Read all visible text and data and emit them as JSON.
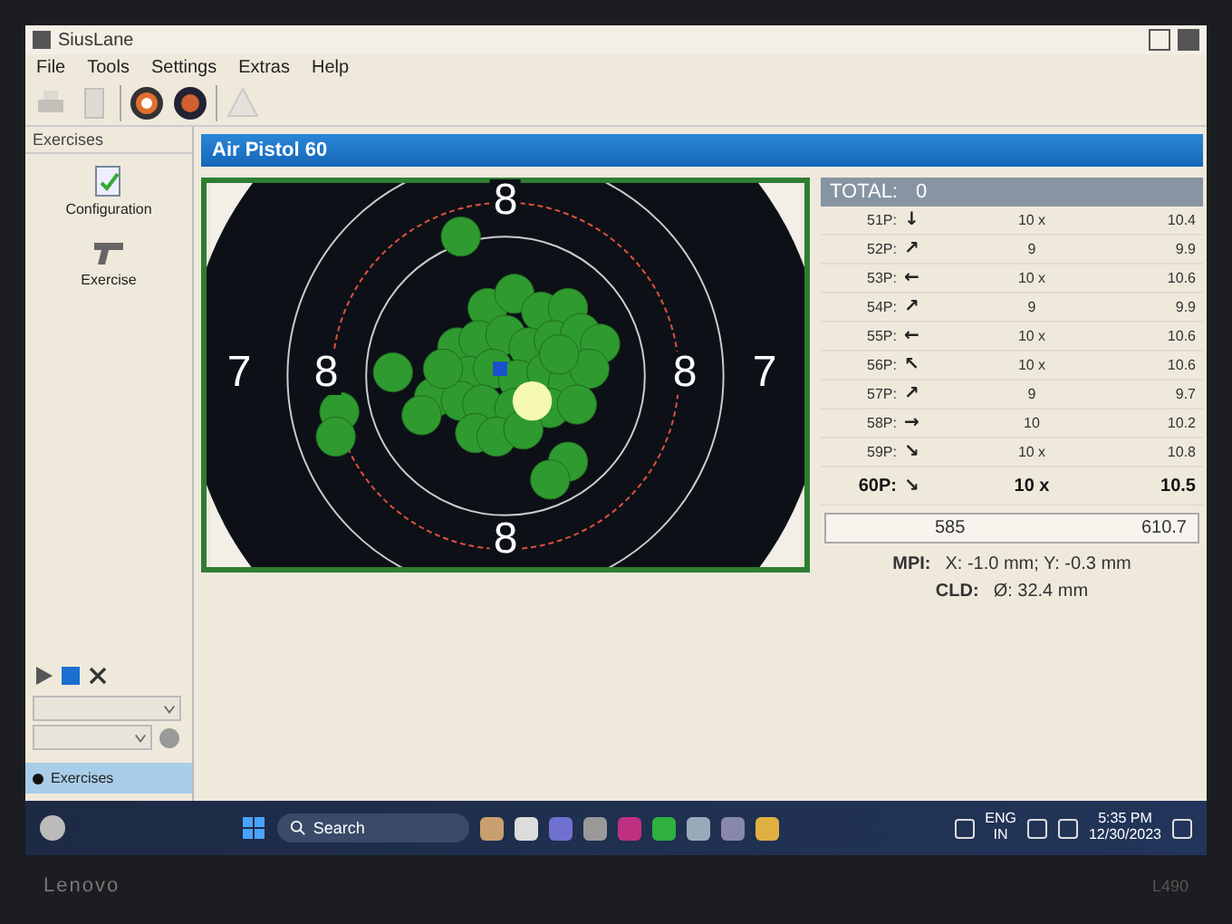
{
  "window": {
    "title": "SiusLane"
  },
  "menu": [
    "File",
    "Tools",
    "Settings",
    "Extras",
    "Help"
  ],
  "toolbar": [
    {
      "kind": "print",
      "disabled": true
    },
    {
      "kind": "document",
      "disabled": true
    },
    {
      "kind": "target",
      "disabled": false
    },
    {
      "kind": "target-dark",
      "disabled": false
    },
    {
      "kind": "warning",
      "disabled": true
    }
  ],
  "sidebar": {
    "title": "Exercises",
    "items": [
      {
        "kind": "configuration",
        "label": "Configuration"
      },
      {
        "kind": "pistol",
        "label": "Exercise"
      }
    ],
    "footer_tab": "Exercises"
  },
  "exercise": {
    "title": "Air Pistol 60"
  },
  "target": {
    "ring_labels": [
      "8",
      "7",
      "8",
      "8",
      "7",
      "8"
    ]
  },
  "scores": {
    "total_label": "TOTAL:",
    "total": "0",
    "rows": [
      {
        "shot": "51P:",
        "direction": "↓",
        "score": "10 x",
        "value": "10.4",
        "selected": false
      },
      {
        "shot": "52P:",
        "direction": "↗",
        "score": "9",
        "value": "9.9",
        "selected": false
      },
      {
        "shot": "53P:",
        "direction": "←",
        "score": "10 x",
        "value": "10.6",
        "selected": false
      },
      {
        "shot": "54P:",
        "direction": "↗",
        "score": "9",
        "value": "9.9",
        "selected": false
      },
      {
        "shot": "55P:",
        "direction": "←",
        "score": "10 x",
        "value": "10.6",
        "selected": false
      },
      {
        "shot": "56P:",
        "direction": "↖",
        "score": "10 x",
        "value": "10.6",
        "selected": false
      },
      {
        "shot": "57P:",
        "direction": "↗",
        "score": "9",
        "value": "9.7",
        "selected": false
      },
      {
        "shot": "58P:",
        "direction": "→",
        "score": "10",
        "value": "10.2",
        "selected": false
      },
      {
        "shot": "59P:",
        "direction": "↘",
        "score": "10 x",
        "value": "10.8",
        "selected": false
      },
      {
        "shot": "60P:",
        "direction": "↘",
        "score": "10 x",
        "value": "10.5",
        "selected": true
      }
    ],
    "sum": "585",
    "sum_decimal": "610.7",
    "mpi_label": "MPI:",
    "mpi": "X: -1.0 mm; Y: -0.3 mm",
    "cld_label": "CLD:",
    "cld": "Ø: 32.4 mm"
  },
  "taskbar": {
    "search_placeholder": "Search",
    "language": "ENG",
    "region": "IN",
    "time": "5:35 PM",
    "date": "12/30/2023"
  },
  "bezel": {
    "brand": "Lenovo",
    "model": "L490"
  }
}
